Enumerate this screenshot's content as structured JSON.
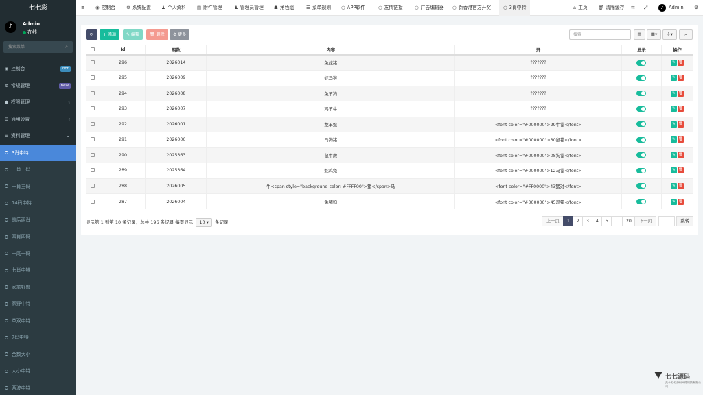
{
  "sidebar": {
    "logo": "七七彩",
    "user": {
      "name": "Admin",
      "status": "在线"
    },
    "search_placeholder": "搜索菜单",
    "items": [
      {
        "label": "控制台",
        "badge": "hot",
        "badge_color": "#3c8dbc"
      },
      {
        "label": "常规管理",
        "badge": "new",
        "badge_color": "#605ca8"
      },
      {
        "label": "权限管理"
      },
      {
        "label": "通用设置"
      },
      {
        "label": "资料管理"
      }
    ],
    "sub_items": [
      "3肖中特",
      "一肖一码",
      "一肖三码",
      "14码中特",
      "前后两肖",
      "四肖四码",
      "一尾一码",
      "七肖中特",
      "家禽野兽",
      "家野中特",
      "单双中特",
      "7码中特",
      "合数大小",
      "大小中特",
      "两波中特",
      "五肖三码"
    ]
  },
  "topbar": {
    "tabs": [
      {
        "label": "控制台",
        "icon": "dashboard-icon"
      },
      {
        "label": "系统配置",
        "icon": "cog-icon"
      },
      {
        "label": "个人资料",
        "icon": "user-icon"
      },
      {
        "label": "附件管理",
        "icon": "file-icon"
      },
      {
        "label": "管理员管理",
        "icon": "user-icon"
      },
      {
        "label": "角色组",
        "icon": "group-icon"
      },
      {
        "label": "菜单规则",
        "icon": "list-icon"
      },
      {
        "label": "APP软件",
        "icon": "circle-icon"
      },
      {
        "label": "友情链接",
        "icon": "circle-icon"
      },
      {
        "label": "广告编辑器",
        "icon": "circle-icon"
      },
      {
        "label": "新香港官方开奖",
        "icon": "circle-icon"
      },
      {
        "label": "3肖中特",
        "icon": "circle-icon"
      }
    ],
    "home": "主页",
    "clear_cache": "清除缓存",
    "admin": "Admin"
  },
  "toolbar": {
    "add": "添加",
    "edit": "编辑",
    "delete": "删除",
    "more": "更多",
    "search_placeholder": "搜索"
  },
  "table": {
    "headers": [
      "Id",
      "期数",
      "内容",
      "开",
      "显示",
      "操作"
    ],
    "rows": [
      {
        "id": "296",
        "period": "2026014",
        "content": "兔蛇猪",
        "open": "???????"
      },
      {
        "id": "295",
        "period": "2026009",
        "content": "蛇马猴",
        "open": "???????"
      },
      {
        "id": "294",
        "period": "2026008",
        "content": "兔羊狗",
        "open": "???????"
      },
      {
        "id": "293",
        "period": "2026007",
        "content": "鸡羊牛",
        "open": "???????"
      },
      {
        "id": "292",
        "period": "2026001",
        "content": "龙羊蛇",
        "open": "<font color=\"#000000\">29牛错</font>"
      },
      {
        "id": "291",
        "period": "2026006",
        "content": "马狗猪",
        "open": "<font color=\"#000000\">30鼠错</font>"
      },
      {
        "id": "290",
        "period": "2025363",
        "content": "鼠牛虎",
        "open": "<font color=\"#000000\">08狗错</font>"
      },
      {
        "id": "289",
        "period": "2025364",
        "content": "蛇鸡兔",
        "open": "<font color=\"#000000\">12马错</font>"
      },
      {
        "id": "288",
        "period": "2026005",
        "content": "牛<span style=\"background-color: #FFFF00\">猪</span>马",
        "open": "<font color=\"#FF0000\">43猪对</font>"
      },
      {
        "id": "287",
        "period": "2026004",
        "content": "兔猪狗",
        "open": "<font color=\"#000000\">45鸡错</font>"
      }
    ]
  },
  "footer": {
    "info": "显示第 1 到第 10 条记录，总共 196 条记录 每页显示",
    "page_size": "10",
    "suffix": "条记录"
  },
  "pager": {
    "prev": "上一页",
    "pages": [
      "1",
      "2",
      "3",
      "4",
      "5",
      "...",
      "20"
    ],
    "next": "下一页",
    "go": "跳转"
  },
  "watermark": {
    "name": "七七源码",
    "tagline": "关于七七源码网络科技有限公司"
  },
  "colors": {
    "accent": "#18bc9c",
    "sidebar_bg": "#222d32",
    "active": "#4a88da",
    "danger": "#e74c3c",
    "primary_dark": "#444c69"
  }
}
